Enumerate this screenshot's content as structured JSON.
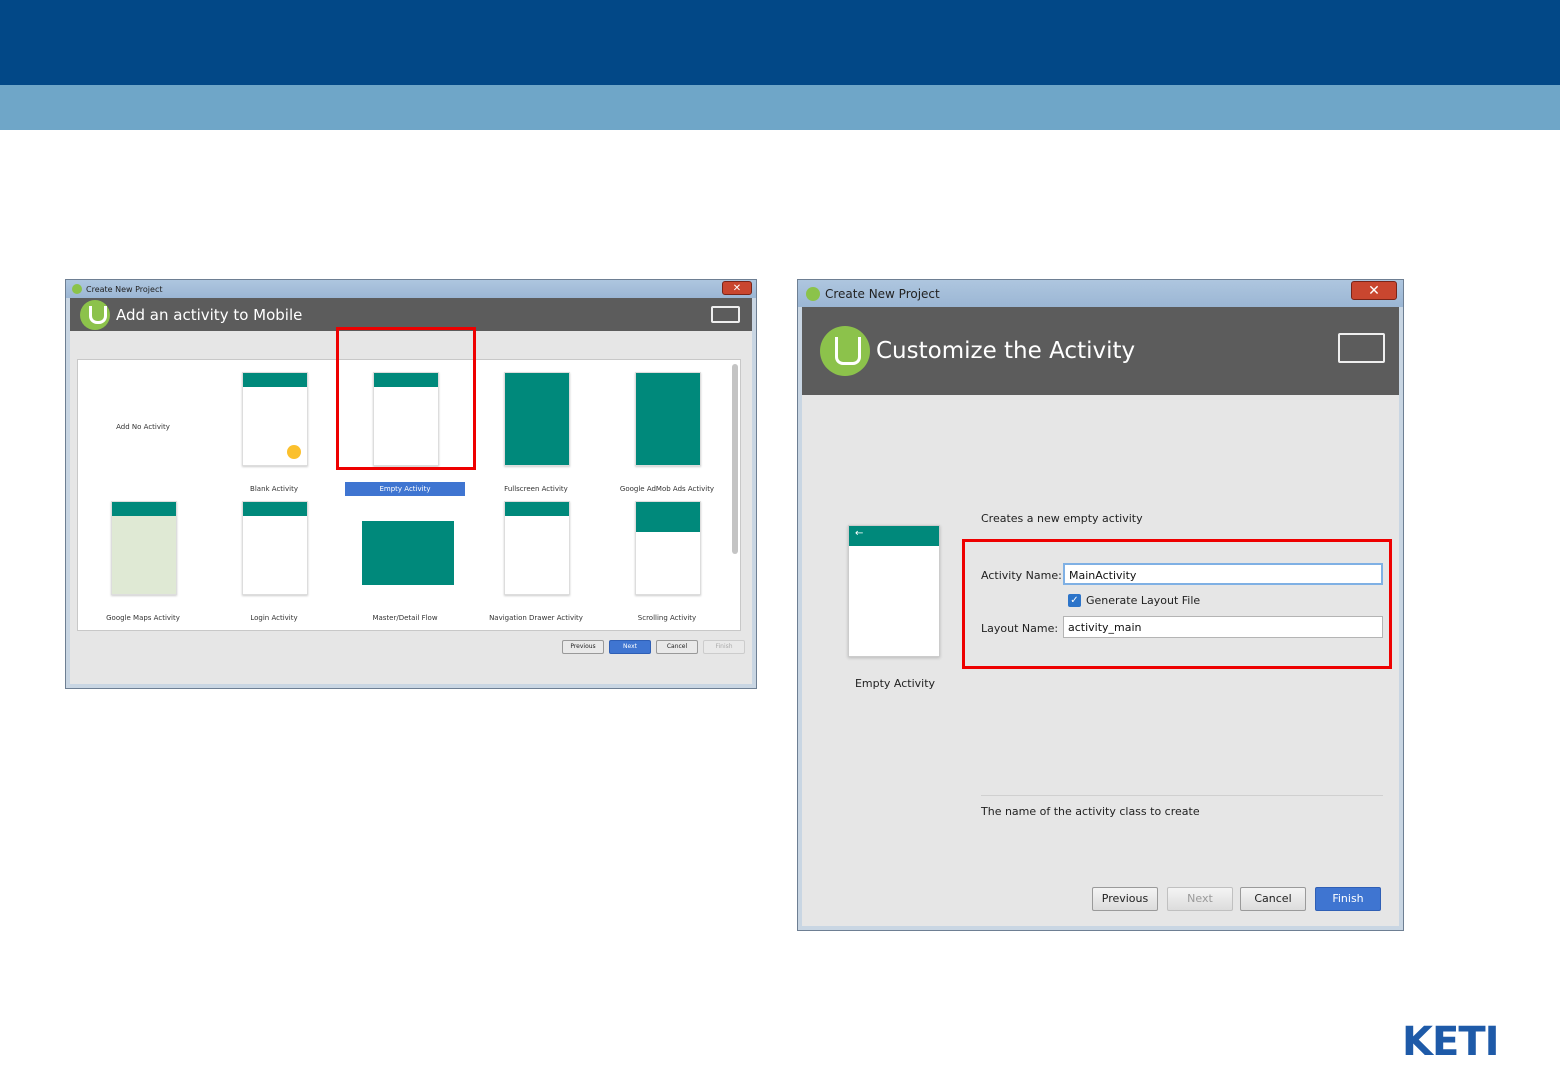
{
  "window_left": {
    "titlebar": "Create New Project",
    "header_title": "Add an activity to Mobile",
    "tiles": [
      {
        "label": "Add No Activity"
      },
      {
        "label": "Blank Activity"
      },
      {
        "label": "Empty Activity"
      },
      {
        "label": "Fullscreen Activity"
      },
      {
        "label": "Google AdMob Ads Activity"
      },
      {
        "label": "Google Maps Activity"
      },
      {
        "label": "Login Activity"
      },
      {
        "label": "Master/Detail Flow"
      },
      {
        "label": "Navigation Drawer Activity"
      },
      {
        "label": "Scrolling Activity"
      }
    ],
    "buttons": {
      "previous": "Previous",
      "next": "Next",
      "cancel": "Cancel",
      "finish": "Finish"
    }
  },
  "window_right": {
    "titlebar": "Create New Project",
    "header_title": "Customize the Activity",
    "preview_label": "Empty Activity",
    "description": "Creates a new empty activity",
    "activity_name_label": "Activity Name:",
    "activity_name_value": "MainActivity",
    "generate_layout_label": "Generate Layout File",
    "layout_name_label": "Layout Name:",
    "layout_name_value": "activity_main",
    "hint": "The name of the activity class to create",
    "buttons": {
      "previous": "Previous",
      "next": "Next",
      "cancel": "Cancel",
      "finish": "Finish"
    }
  },
  "logo_text": "KETI",
  "colors": {
    "header_blue": "#024887",
    "sub_band": "#6fa6c8",
    "teal": "#00897b",
    "highlight_red": "#ee0000"
  }
}
